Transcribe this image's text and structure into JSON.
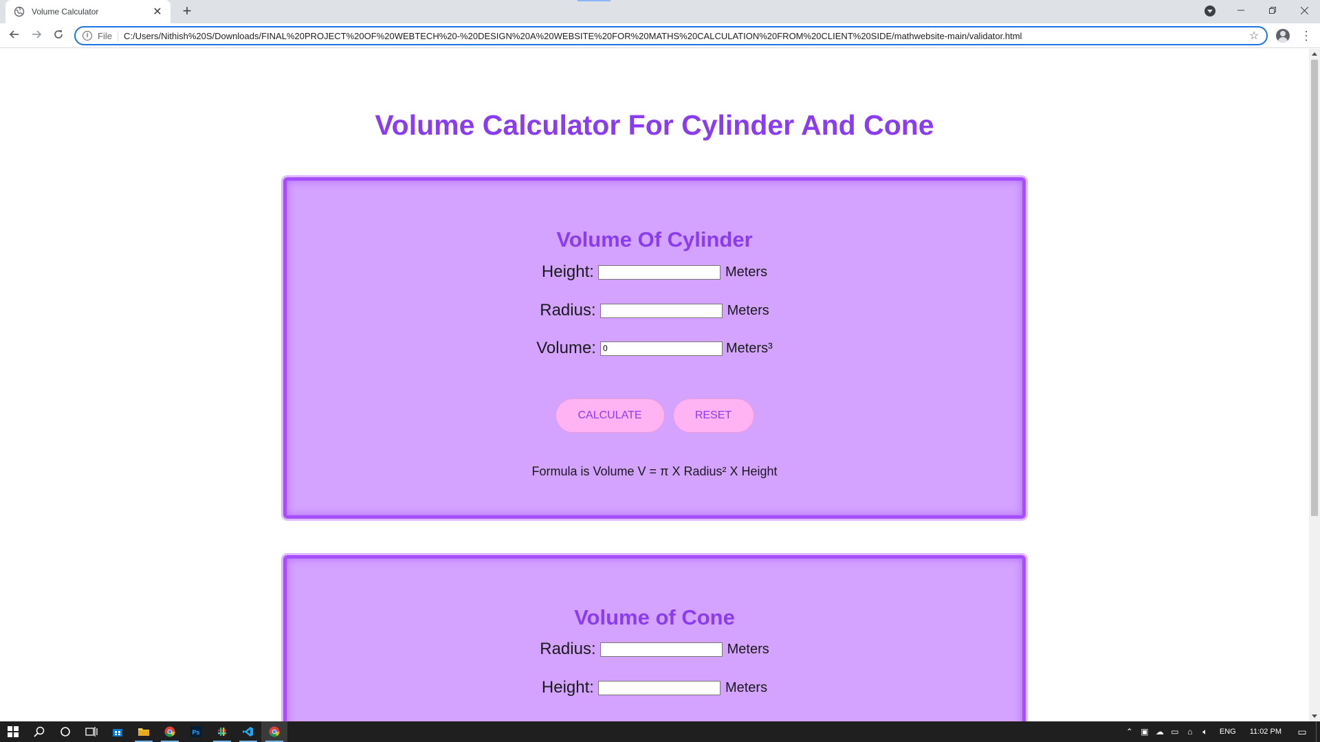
{
  "browser": {
    "tab_title": "Volume Calculator",
    "new_tab_label": "+",
    "scheme_label": "File",
    "url": "C:/Users/Nithish%20S/Downloads/FINAL%20PROJECT%20OF%20WEBTECH%20-%20DESIGN%20A%20WEBSITE%20FOR%20MATHS%20CALCULATION%20FROM%20CLIENT%20SIDE/mathwebsite-main/validator.html"
  },
  "page": {
    "title": "Volume Calculator For Cylinder And Cone"
  },
  "cylinder": {
    "heading": "Volume Of Cylinder",
    "height_label": "Height:",
    "height_value": "",
    "height_unit": "Meters",
    "radius_label": "Radius:",
    "radius_value": "",
    "radius_unit": "Meters",
    "volume_label": "Volume:",
    "volume_value": "0",
    "volume_unit": "Meters³",
    "calculate_label": "CALCULATE",
    "reset_label": "RESET",
    "formula": "Formula is Volume V = π X Radius² X Height"
  },
  "cone": {
    "heading": "Volume of Cone",
    "radius_label": "Radius:",
    "radius_value": "",
    "radius_unit": "Meters",
    "height_label": "Height:",
    "height_value": "",
    "height_unit": "Meters"
  },
  "taskbar": {
    "language": "ENG",
    "time": "11:02 PM"
  },
  "colors": {
    "accent": "#8a3cf0",
    "card_background": "#d4a3ff",
    "card_border": "#a64dfc",
    "button_background": "#ffb3f2"
  }
}
